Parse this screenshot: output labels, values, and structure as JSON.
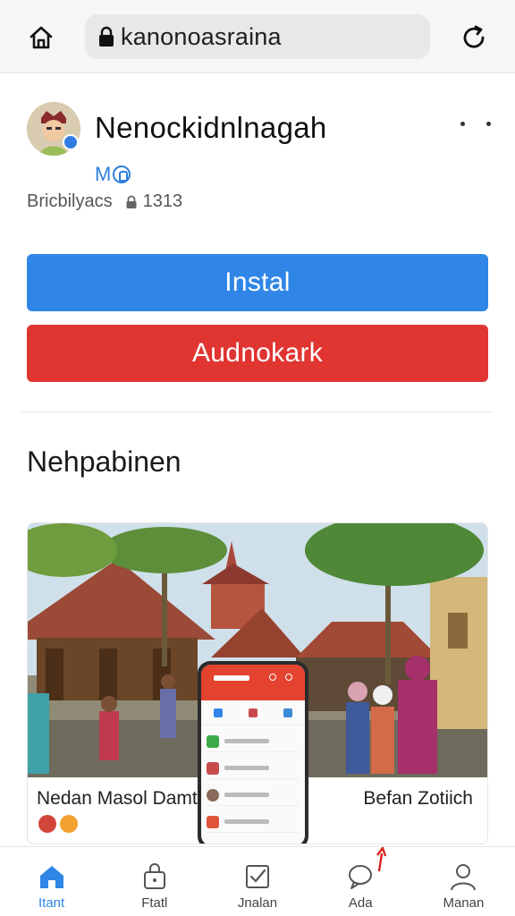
{
  "browser": {
    "url": "kanonoasraina"
  },
  "app": {
    "name": "Nenockidnlnagah",
    "verified_label": "M",
    "developer": "Bricbilyacs",
    "rating_count": "1313",
    "more_icon": "more-dots-icon"
  },
  "buttons": {
    "install": "Instal",
    "secondary": "Audnokark"
  },
  "section": {
    "title": "Nehpabinen"
  },
  "preview": {
    "caption_left": "Nedan Masol Damtl",
    "caption_right": "Befan Zotiich"
  },
  "bottom_nav": {
    "items": [
      {
        "label": "Itant",
        "icon": "home-icon",
        "active": true
      },
      {
        "label": "Ftatl",
        "icon": "lock-bag-icon",
        "active": false
      },
      {
        "label": "Jnalan",
        "icon": "checklist-icon",
        "active": false
      },
      {
        "label": "Ada",
        "icon": "chat-bubble-icon",
        "active": false
      },
      {
        "label": "Manan",
        "icon": "person-icon",
        "active": false
      }
    ]
  },
  "colors": {
    "install": "#2f86e6",
    "secondary": "#e03531",
    "accent": "#2d7fdc"
  }
}
